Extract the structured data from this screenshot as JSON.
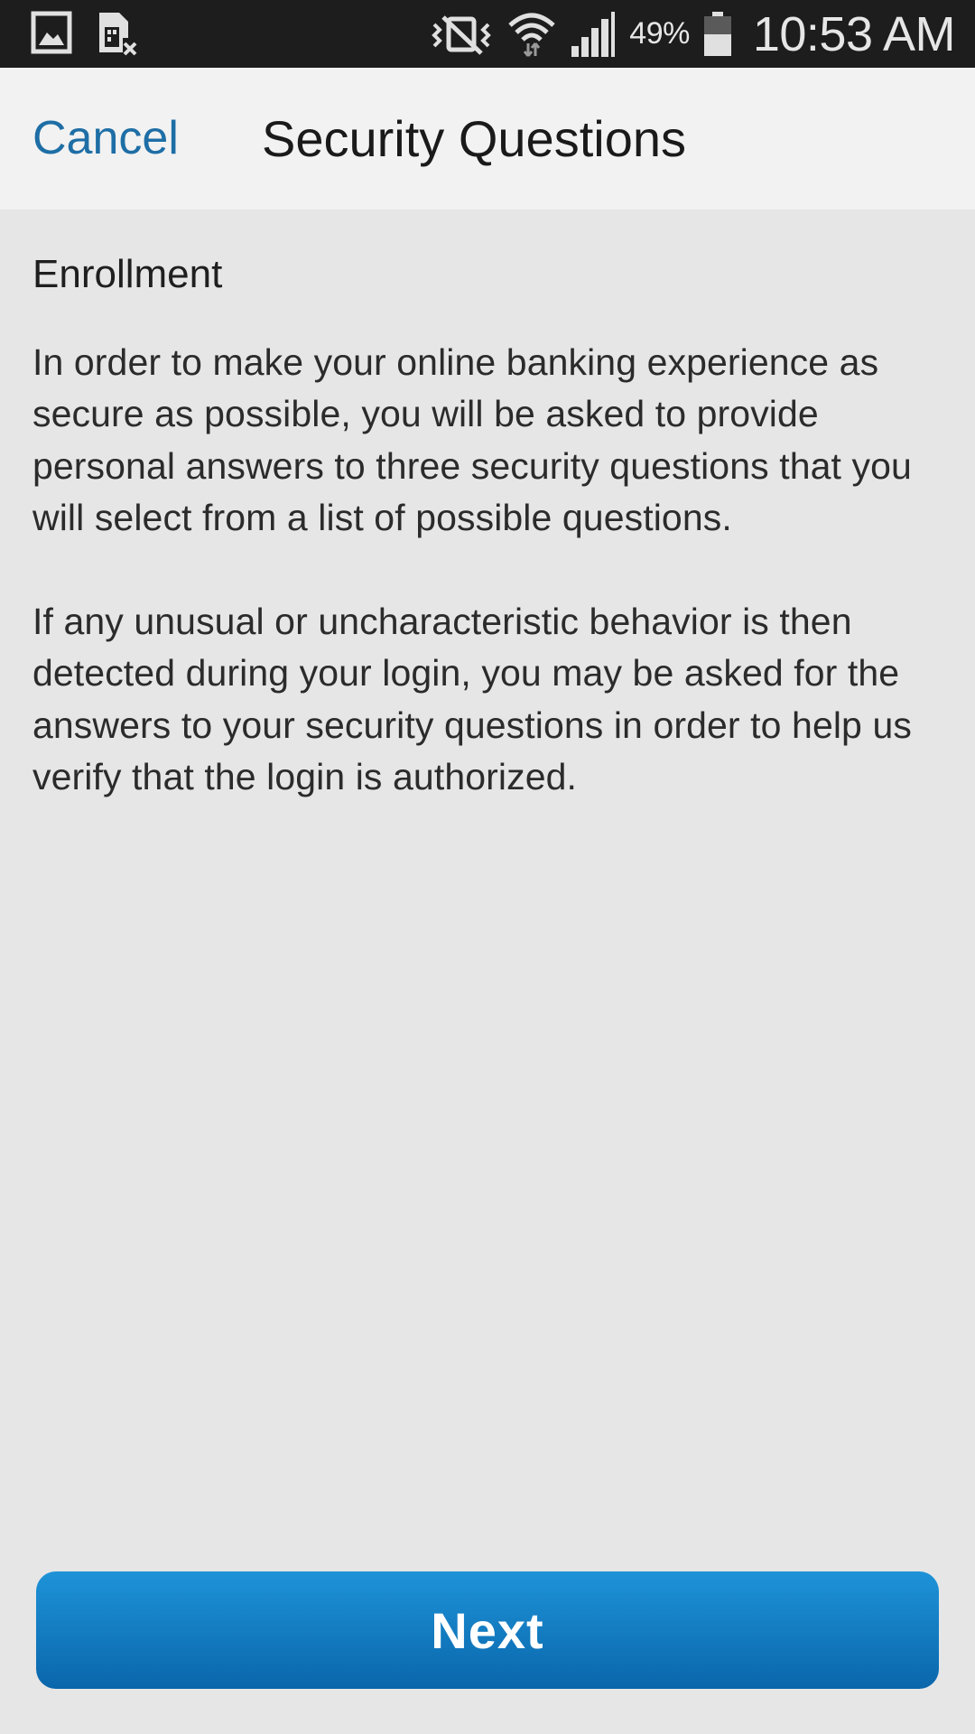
{
  "status_bar": {
    "icons_left": [
      "gallery-icon",
      "sim-error-icon"
    ],
    "icons_right": [
      "vibrate-mute-icon",
      "wifi-icon",
      "signal-icon",
      "battery-icon"
    ],
    "battery_percent": "49%",
    "time": "10:53 AM"
  },
  "header": {
    "cancel_label": "Cancel",
    "title": "Security Questions"
  },
  "content": {
    "heading": "Enrollment",
    "paragraphs": [
      "In order to make your online banking experience as secure as possible, you will be asked to provide personal answers to three security questions that you will select from a list of possible questions.",
      "If any unusual or uncharacteristic behavior is then detected during your login, you may be asked for the answers to your security questions in order to help us verify that the login is authorized."
    ]
  },
  "footer": {
    "next_label": "Next"
  },
  "colors": {
    "accent": "#1e6ea6",
    "button_top": "#1e93d8",
    "button_bottom": "#0a66ab",
    "background": "#e6e6e7",
    "header_bg": "#f2f2f2",
    "status_bar_bg": "#1d1d1d"
  }
}
